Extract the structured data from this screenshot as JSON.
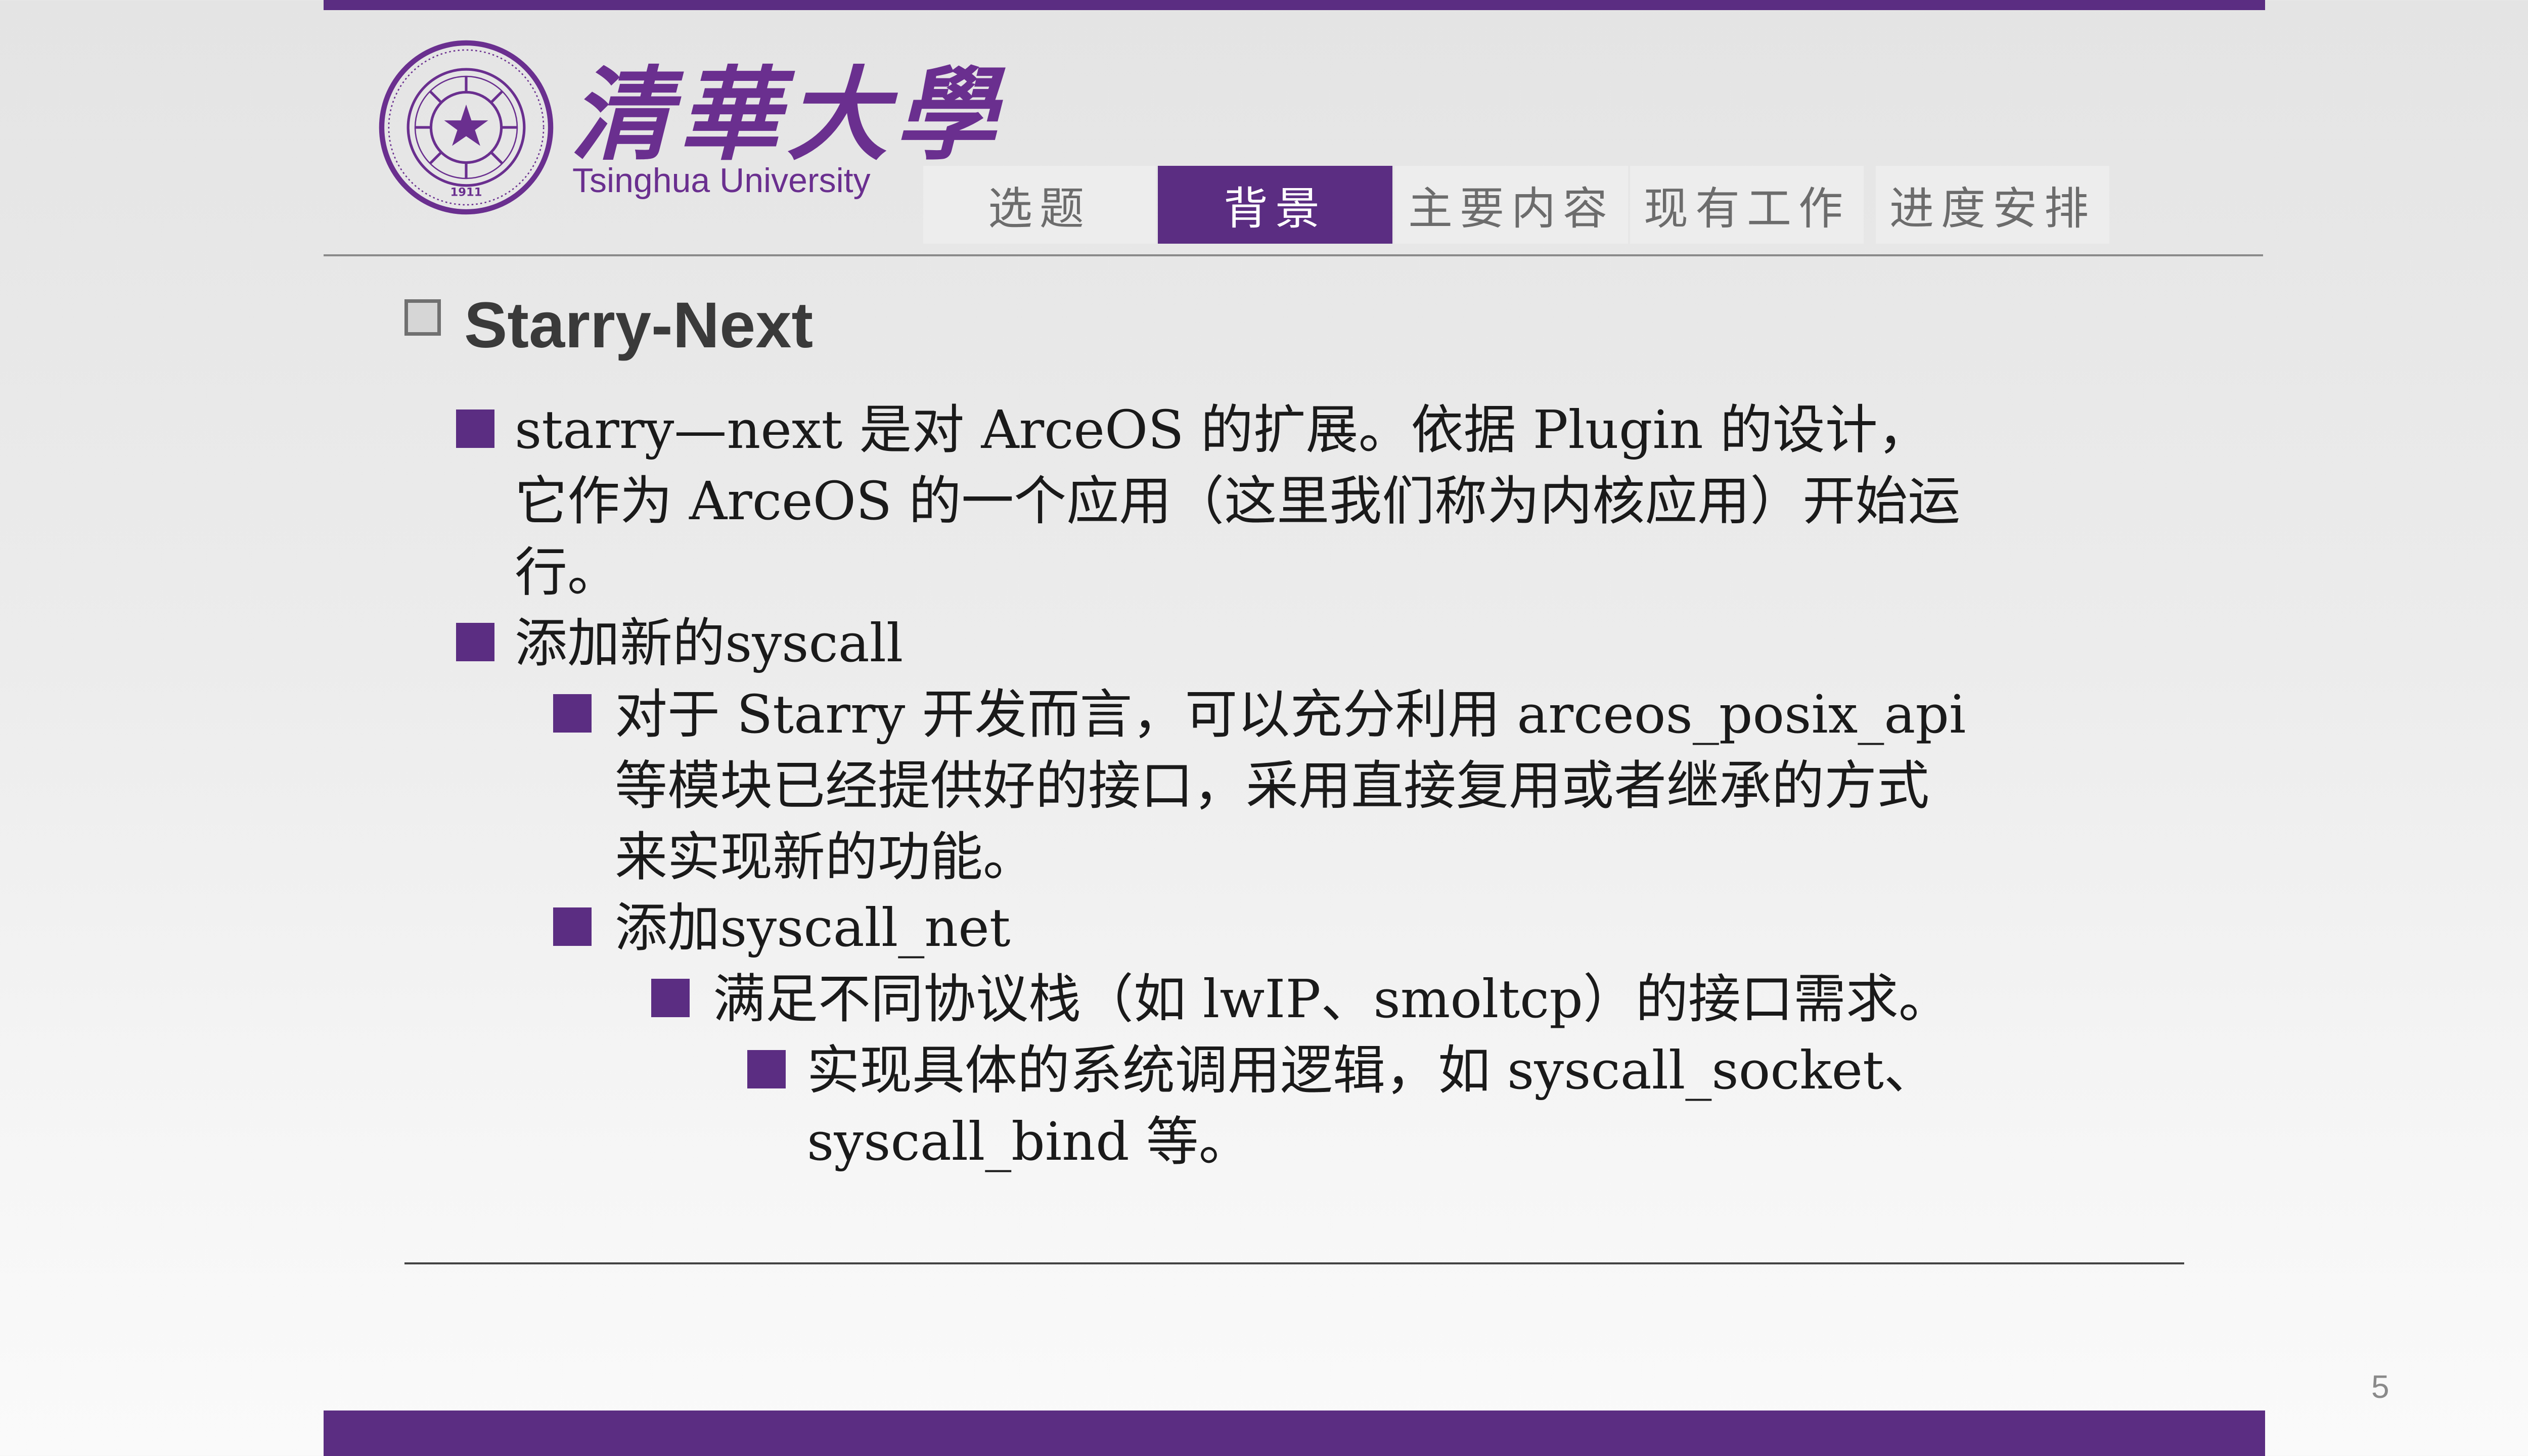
{
  "logo": {
    "name_cn": "清華大學",
    "name_en": "Tsinghua University",
    "seal_year": "1911"
  },
  "nav": {
    "tabs": [
      {
        "label": "选题",
        "active": false
      },
      {
        "label": "背景",
        "active": true
      },
      {
        "label": "主要内容",
        "active": false
      },
      {
        "label": "现有工作",
        "active": false
      },
      {
        "label": "进度安排",
        "active": false
      }
    ]
  },
  "slide": {
    "title": "Starry-Next",
    "bullets": {
      "b1": "starry—next 是对 ArceOS 的扩展。依据 Plugin 的设计，它作为 ArceOS 的一个应用（这里我们称为内核应用）开始运行。",
      "b2": "添加新的syscall",
      "b3": "对于 Starry 开发而言，可以充分利用 arceos_posix_api 等模块已经提供好的接口，采用直接复用或者继承的方式来实现新的功能。",
      "b4": "添加syscall_net",
      "b5": "满足不同协议栈（如 lwIP、smoltcp）的接口需求。",
      "b6": "实现具体的系统调用逻辑，如 syscall_socket、",
      "b6_cont": "syscall_bind 等。"
    },
    "page_number": "5"
  },
  "colors": {
    "accent": "#5b2d82",
    "logo": "#6a2f8f",
    "tab_bg": "#ededed",
    "tab_text": "#6c6c6c"
  }
}
